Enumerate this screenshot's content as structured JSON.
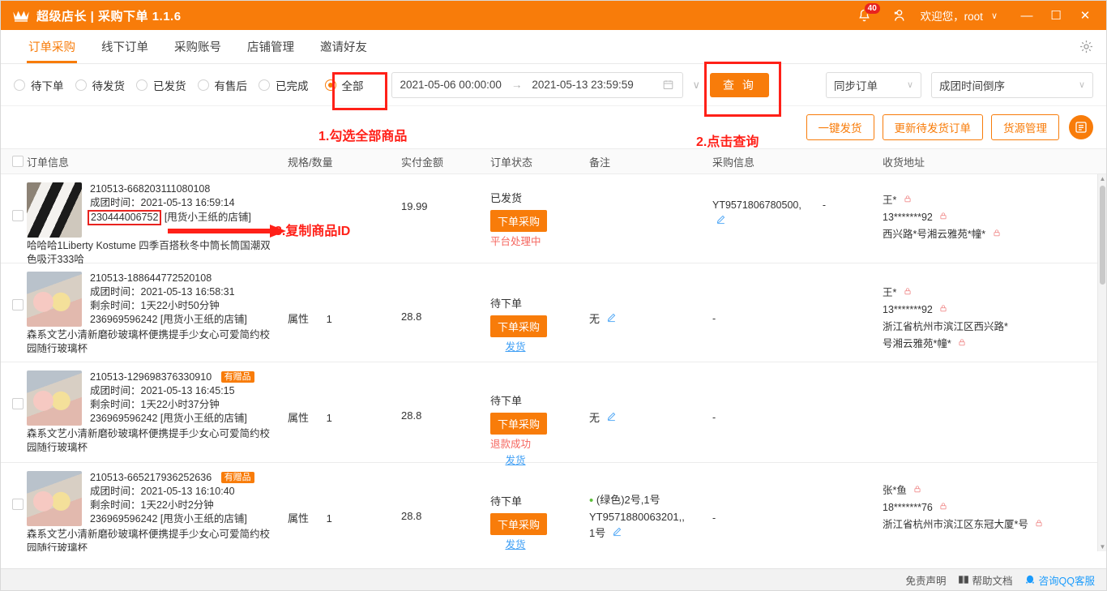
{
  "titlebar": {
    "app_title": "超级店长 | 采购下单 1.1.6",
    "crown_icon": "crown-icon",
    "bell_icon": "bell-icon",
    "notification_count": "40",
    "user_icon": "user-icon",
    "welcome_text": "欢迎您，root",
    "dropdown_caret": "∨",
    "minimize": "—",
    "maximize": "☐",
    "close": "✕"
  },
  "nav": {
    "items": [
      {
        "label": "订单采购",
        "active": true
      },
      {
        "label": "线下订单",
        "active": false
      },
      {
        "label": "采购账号",
        "active": false
      },
      {
        "label": "店铺管理",
        "active": false
      },
      {
        "label": "邀请好友",
        "active": false
      }
    ],
    "settings_icon": "gear-icon"
  },
  "filters": {
    "radios": [
      {
        "label": "待下单",
        "checked": false
      },
      {
        "label": "待发货",
        "checked": false
      },
      {
        "label": "已发货",
        "checked": false
      },
      {
        "label": "有售后",
        "checked": false
      },
      {
        "label": "已完成",
        "checked": false
      },
      {
        "label": "全部",
        "checked": true
      }
    ],
    "date_start": "2021-05-06 00:00:00",
    "date_arrow": "→",
    "date_end": "2021-05-13 23:59:59",
    "calendar_icon": "calendar-icon",
    "filter_icon": "funnel-icon",
    "query_button": "查 询",
    "sync_select": "同步订单",
    "sort_select": "成团时间倒序"
  },
  "actions": {
    "one_key_ship": "一键发货",
    "update_pending": "更新待发货订单",
    "supply_manage": "货源管理",
    "list_icon": "list-menu-icon"
  },
  "table": {
    "headers": {
      "order_info": "订单信息",
      "spec_qty": "规格/数量",
      "paid_amount": "实付金额",
      "order_status": "订单状态",
      "remark": "备注",
      "purchase_info": "采购信息",
      "shipping_address": "收货地址"
    },
    "rows": [
      {
        "thumb": "sock-thumbnail",
        "order_no": "210513-668203111080108",
        "group_time": "成团时间：2021-05-13 16:59:14",
        "remain_time": "",
        "product_id": "230444006752",
        "shop_name": "[甩货小王纸的店铺]",
        "product_title": "哈哈哈1Liberty Kostume 四季百搭秋冬中筒长筒国潮双色吸汗333哈",
        "gift_badge": "",
        "spec_label": "",
        "qty": "",
        "amount": "19.99",
        "status": "已发货",
        "action_button": "下单采购",
        "status_sub": "平台处理中",
        "status_sub_kind": "red",
        "remark": "",
        "purchase_info": "YT9571806780500,",
        "purchase_spec": "",
        "edit_icon": "pencil-icon",
        "dash": "-",
        "addr_name": "王*",
        "addr_phone": "13*******92",
        "addr_detail": "西兴路*号湘云雅苑*幢*",
        "addr_detail2": "",
        "lock_icon": "lock-icon"
      },
      {
        "thumb": "cup-thumbnail",
        "order_no": "210513-188644772520108",
        "group_time": "成团时间：2021-05-13 16:58:31",
        "remain_time": "剩余时间：1天22小时50分钟",
        "product_id": "236969596242",
        "shop_name": "[甩货小王纸的店铺]",
        "product_title": "森系文艺小清新磨砂玻璃杯便携提手少女心可爱简约校园随行玻璃杯",
        "gift_badge": "",
        "spec_label": "属性",
        "qty": "1",
        "amount": "28.8",
        "status": "待下单",
        "action_button": "下单采购",
        "status_sub": "发货",
        "status_sub_kind": "link",
        "remark": "无",
        "purchase_info": "",
        "purchase_spec": "",
        "edit_icon": "pencil-icon",
        "dash": "-",
        "addr_name": "王*",
        "addr_phone": "13*******92",
        "addr_detail": "浙江省杭州市滨江区西兴路*",
        "addr_detail2": "号湘云雅苑*幢*",
        "lock_icon": "lock-icon"
      },
      {
        "thumb": "cup-thumbnail",
        "order_no": "210513-129698376330910",
        "group_time": "成团时间：2021-05-13 16:45:15",
        "remain_time": "剩余时间：1天22小时37分钟",
        "product_id": "236969596242",
        "shop_name": "[甩货小王纸的店铺]",
        "product_title": "森系文艺小清新磨砂玻璃杯便携提手少女心可爱简约校园随行玻璃杯",
        "gift_badge": "有赠品",
        "spec_label": "属性",
        "qty": "1",
        "amount": "28.8",
        "status": "待下单",
        "action_button": "下单采购",
        "status_sub": "退款成功",
        "status_sub_kind": "red",
        "status_sub2": "发货",
        "remark": "无",
        "purchase_info": "",
        "purchase_spec": "",
        "edit_icon": "pencil-icon",
        "dash": "-",
        "addr_name": "",
        "addr_phone": "",
        "addr_detail": "",
        "addr_detail2": "",
        "lock_icon": "lock-icon"
      },
      {
        "thumb": "cup-thumbnail",
        "order_no": "210513-665217936252636",
        "group_time": "成团时间：2021-05-13 16:10:40",
        "remain_time": "剩余时间：1天22小时2分钟",
        "product_id": "236969596242",
        "shop_name": "[甩货小王纸的店铺]",
        "product_title": "森系文艺小清新磨砂玻璃杯便携提手少女心可爱简约校园随行玻璃杯",
        "gift_badge": "有赠品",
        "spec_label": "属性",
        "qty": "1",
        "amount": "28.8",
        "status": "待下单",
        "action_button": "下单采购",
        "status_sub": "发货",
        "status_sub_kind": "link",
        "remark": "",
        "purchase_spec": "(绿色)2号,1号",
        "purchase_info": "YT9571880063201,,",
        "purchase_line3": "1号",
        "edit_icon": "pencil-icon",
        "dash": "-",
        "addr_name": "张*鱼",
        "addr_phone": "18*******76",
        "addr_detail": "浙江省杭州市滨江区东冠大厦*号",
        "addr_detail2": "",
        "lock_icon": "lock-icon"
      }
    ]
  },
  "annotations": {
    "step1": "1.勾选全部商品",
    "step2": "2.点击查询",
    "step3": "3.复制商品ID"
  },
  "footer": {
    "disclaimer": "免责声明",
    "help_icon": "book-icon",
    "help_doc": "帮助文档",
    "qq_icon": "qq-penguin-icon",
    "qq_service": "咨询QQ客服"
  },
  "colors": {
    "brand": "#f87c0a",
    "annotation_red": "#ff2018",
    "link_blue": "#3f9ff5",
    "badge_red": "#e8231f"
  }
}
